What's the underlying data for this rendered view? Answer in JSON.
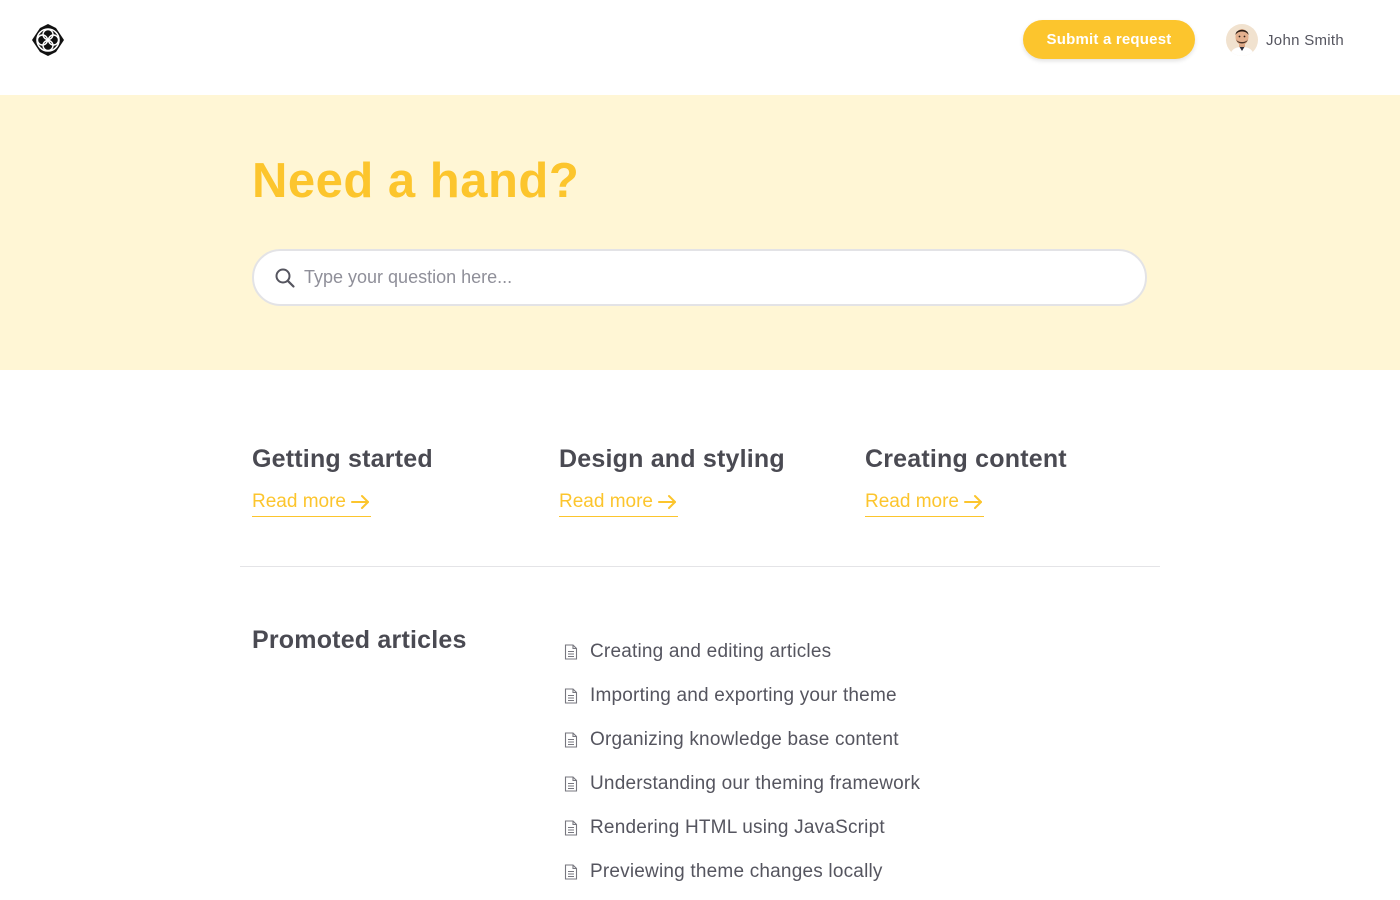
{
  "header": {
    "logo_icon": "brand-logo-icon",
    "submit_label": "Submit a request",
    "user_name": "John Smith"
  },
  "hero": {
    "title": "Need a hand?",
    "search_placeholder": "Type your question here..."
  },
  "categories": [
    {
      "title": "Getting started",
      "link": "Read more"
    },
    {
      "title": "Design and styling",
      "link": "Read more"
    },
    {
      "title": "Creating content",
      "link": "Read more"
    }
  ],
  "promoted": {
    "title": "Promoted articles",
    "articles": [
      "Creating and editing articles",
      "Importing and exporting your theme",
      "Organizing knowledge base content",
      "Understanding our theming framework",
      "Rendering HTML using JavaScript",
      "Previewing theme changes locally"
    ]
  },
  "colors": {
    "accent": "#fcc52d",
    "hero_bg": "#fff6d5",
    "text": "#4a4a52"
  }
}
